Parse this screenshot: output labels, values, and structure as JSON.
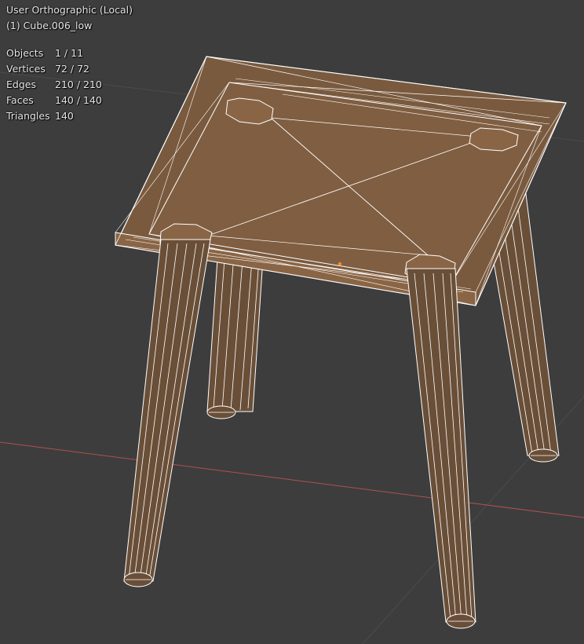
{
  "viewport": {
    "view_name": "User Orthographic (Local)",
    "active_object": "(1) Cube.006_low",
    "background_color": "#3d3d3d",
    "stats": [
      {
        "label": "Objects",
        "value": "1 / 11"
      },
      {
        "label": "Vertices",
        "value": "72 / 72"
      },
      {
        "label": "Edges",
        "value": "210 / 210"
      },
      {
        "label": "Faces",
        "value": "140 / 140"
      },
      {
        "label": "Triangles",
        "value": "140"
      }
    ]
  },
  "scene": {
    "object_type": "low-poly stool mesh",
    "face_color": "#7a5a3e",
    "wire_color": "#ffffff",
    "x_axis_color": "#b0504f",
    "grid_color": "#555555",
    "origin_color": "#ff8c1a"
  }
}
